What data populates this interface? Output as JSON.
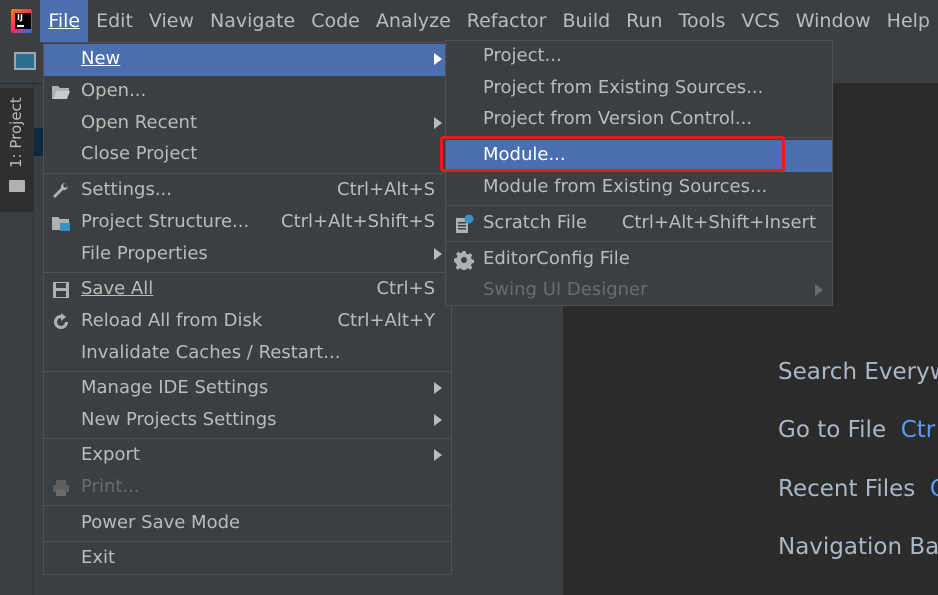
{
  "menubar": {
    "logo_text": "IJ",
    "items": [
      {
        "label": "File",
        "active": true
      },
      {
        "label": "Edit"
      },
      {
        "label": "View"
      },
      {
        "label": "Navigate"
      },
      {
        "label": "Code"
      },
      {
        "label": "Analyze"
      },
      {
        "label": "Refactor"
      },
      {
        "label": "Build"
      },
      {
        "label": "Run"
      },
      {
        "label": "Tools"
      },
      {
        "label": "VCS"
      },
      {
        "label": "Window"
      },
      {
        "label": "Help"
      }
    ]
  },
  "tool_stripe": {
    "project_tab": "1: Project"
  },
  "file_menu": {
    "new": "New",
    "open": "Open...",
    "open_recent": "Open Recent",
    "close_project": "Close Project",
    "settings": "Settings...",
    "settings_sc": "Ctrl+Alt+S",
    "project_structure": "Project Structure...",
    "project_structure_sc": "Ctrl+Alt+Shift+S",
    "file_properties": "File Properties",
    "save_all": "Save All",
    "save_all_sc": "Ctrl+S",
    "reload_all": "Reload All from Disk",
    "reload_all_sc": "Ctrl+Alt+Y",
    "invalidate_caches": "Invalidate Caches / Restart...",
    "manage_ide_settings": "Manage IDE Settings",
    "new_projects_settings": "New Projects Settings",
    "export": "Export",
    "print": "Print...",
    "power_save_mode": "Power Save Mode",
    "exit": "Exit"
  },
  "new_submenu": {
    "project": "Project...",
    "project_from_existing": "Project from Existing Sources...",
    "project_from_vcs": "Project from Version Control...",
    "module": "Module...",
    "module_from_existing": "Module from Existing Sources...",
    "scratch_file": "Scratch File",
    "scratch_file_sc": "Ctrl+Alt+Shift+Insert",
    "editorconfig_file": "EditorConfig File",
    "swing_ui_designer": "Swing UI Designer"
  },
  "welcome_hints": [
    {
      "label": "Search Everyw",
      "key": ""
    },
    {
      "label": "Go to File",
      "key": "Ctr"
    },
    {
      "label": "Recent Files",
      "key": "C"
    },
    {
      "label": "Navigation Ba",
      "key": ""
    }
  ],
  "colors": {
    "selection": "#4b6eaf",
    "highlight_box": "#e81b1b",
    "menu_bg": "#3c3f41",
    "editor_bg": "#2b2b2b",
    "shortcut_key": "#589df6"
  }
}
